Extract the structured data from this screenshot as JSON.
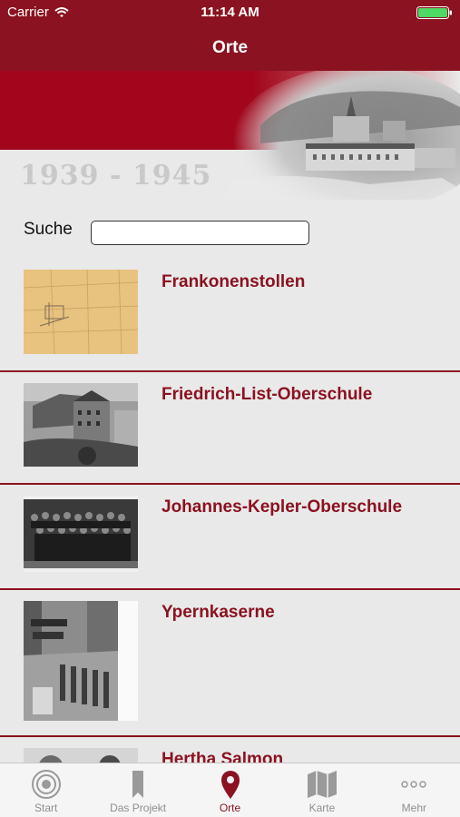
{
  "status_bar": {
    "carrier": "Carrier",
    "time": "11:14 AM"
  },
  "nav": {
    "title": "Orte"
  },
  "banner": {
    "years": "1939 - 1945"
  },
  "search": {
    "label": "Suche",
    "value": ""
  },
  "places": [
    {
      "name": "Frankonenstollen"
    },
    {
      "name": "Friedrich-List-Oberschule"
    },
    {
      "name": "Johannes-Kepler-Oberschule"
    },
    {
      "name": "Ypernkaserne"
    },
    {
      "name": "Hertha Salmon"
    }
  ],
  "tabs": [
    {
      "label": "Start",
      "icon": "target-icon"
    },
    {
      "label": "Das Projekt",
      "icon": "bookmark-icon"
    },
    {
      "label": "Orte",
      "icon": "map-pin-icon"
    },
    {
      "label": "Karte",
      "icon": "map-icon"
    },
    {
      "label": "Mehr",
      "icon": "more-icon"
    }
  ],
  "colors": {
    "brand": "#8b1220",
    "banner_red": "#a1061c",
    "inactive": "#8e8e8e"
  }
}
